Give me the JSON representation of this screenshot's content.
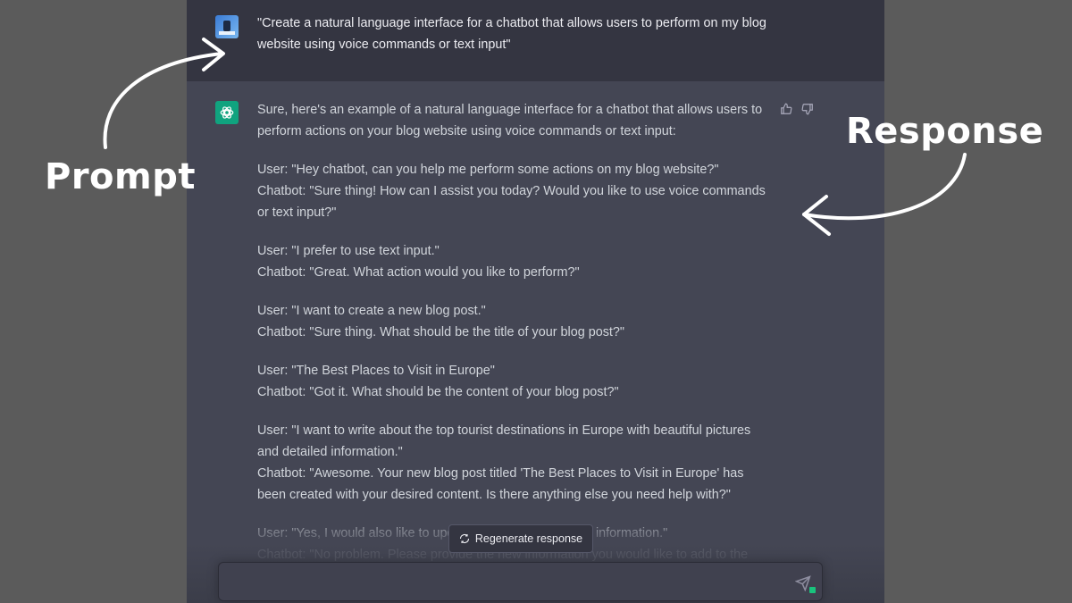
{
  "prompt": {
    "text": "\"Create a natural language interface for a chatbot that allows users to perform on my blog website using voice commands or text input\""
  },
  "response": {
    "paragraphs": [
      [
        "Sure, here's an example of a natural language interface for a chatbot that allows users to perform actions on your blog website using voice commands or text input:"
      ],
      [
        "User: \"Hey chatbot, can you help me perform some actions on my blog website?\"",
        "Chatbot: \"Sure thing! How can I assist you today? Would you like to use voice commands or text input?\""
      ],
      [
        "User: \"I prefer to use text input.\"",
        "Chatbot: \"Great. What action would you like to perform?\""
      ],
      [
        "User: \"I want to create a new blog post.\"",
        "Chatbot: \"Sure thing. What should be the title of your blog post?\""
      ],
      [
        "User: \"The Best Places to Visit in Europe\"",
        "Chatbot: \"Got it. What should be the content of your blog post?\""
      ],
      [
        "User: \"I want to write about the top tourist destinations in Europe with beautiful pictures and detailed information.\"",
        "Chatbot: \"Awesome. Your new blog post titled 'The Best Places to Visit in Europe' has been created with your desired content. Is there anything else you need help with?\""
      ],
      [
        "User: \"Yes, I would also like to update a blog post with new information.\"",
        "Chatbot: \"No problem. Please provide the new information you would like to add to the"
      ]
    ]
  },
  "controls": {
    "regenerate_label": "Regenerate response",
    "input_placeholder": ""
  },
  "annotations": {
    "prompt_label": "Prompt",
    "response_label": "Response"
  },
  "colors": {
    "background": "#5b5b5b",
    "user_row": "#343541",
    "assistant_row": "#444654",
    "brand_green": "#10a37f"
  }
}
